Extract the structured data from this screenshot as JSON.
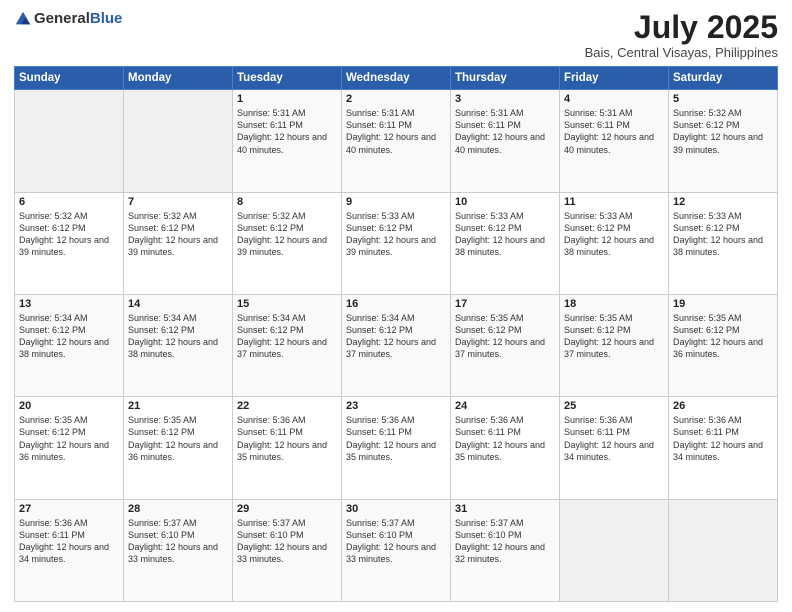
{
  "header": {
    "logo_general": "General",
    "logo_blue": "Blue",
    "title": "July 2025",
    "subtitle": "Bais, Central Visayas, Philippines"
  },
  "weekdays": [
    "Sunday",
    "Monday",
    "Tuesday",
    "Wednesday",
    "Thursday",
    "Friday",
    "Saturday"
  ],
  "weeks": [
    [
      {
        "day": "",
        "text": ""
      },
      {
        "day": "",
        "text": ""
      },
      {
        "day": "1",
        "text": "Sunrise: 5:31 AM\nSunset: 6:11 PM\nDaylight: 12 hours and 40 minutes."
      },
      {
        "day": "2",
        "text": "Sunrise: 5:31 AM\nSunset: 6:11 PM\nDaylight: 12 hours and 40 minutes."
      },
      {
        "day": "3",
        "text": "Sunrise: 5:31 AM\nSunset: 6:11 PM\nDaylight: 12 hours and 40 minutes."
      },
      {
        "day": "4",
        "text": "Sunrise: 5:31 AM\nSunset: 6:11 PM\nDaylight: 12 hours and 40 minutes."
      },
      {
        "day": "5",
        "text": "Sunrise: 5:32 AM\nSunset: 6:12 PM\nDaylight: 12 hours and 39 minutes."
      }
    ],
    [
      {
        "day": "6",
        "text": "Sunrise: 5:32 AM\nSunset: 6:12 PM\nDaylight: 12 hours and 39 minutes."
      },
      {
        "day": "7",
        "text": "Sunrise: 5:32 AM\nSunset: 6:12 PM\nDaylight: 12 hours and 39 minutes."
      },
      {
        "day": "8",
        "text": "Sunrise: 5:32 AM\nSunset: 6:12 PM\nDaylight: 12 hours and 39 minutes."
      },
      {
        "day": "9",
        "text": "Sunrise: 5:33 AM\nSunset: 6:12 PM\nDaylight: 12 hours and 39 minutes."
      },
      {
        "day": "10",
        "text": "Sunrise: 5:33 AM\nSunset: 6:12 PM\nDaylight: 12 hours and 38 minutes."
      },
      {
        "day": "11",
        "text": "Sunrise: 5:33 AM\nSunset: 6:12 PM\nDaylight: 12 hours and 38 minutes."
      },
      {
        "day": "12",
        "text": "Sunrise: 5:33 AM\nSunset: 6:12 PM\nDaylight: 12 hours and 38 minutes."
      }
    ],
    [
      {
        "day": "13",
        "text": "Sunrise: 5:34 AM\nSunset: 6:12 PM\nDaylight: 12 hours and 38 minutes."
      },
      {
        "day": "14",
        "text": "Sunrise: 5:34 AM\nSunset: 6:12 PM\nDaylight: 12 hours and 38 minutes."
      },
      {
        "day": "15",
        "text": "Sunrise: 5:34 AM\nSunset: 6:12 PM\nDaylight: 12 hours and 37 minutes."
      },
      {
        "day": "16",
        "text": "Sunrise: 5:34 AM\nSunset: 6:12 PM\nDaylight: 12 hours and 37 minutes."
      },
      {
        "day": "17",
        "text": "Sunrise: 5:35 AM\nSunset: 6:12 PM\nDaylight: 12 hours and 37 minutes."
      },
      {
        "day": "18",
        "text": "Sunrise: 5:35 AM\nSunset: 6:12 PM\nDaylight: 12 hours and 37 minutes."
      },
      {
        "day": "19",
        "text": "Sunrise: 5:35 AM\nSunset: 6:12 PM\nDaylight: 12 hours and 36 minutes."
      }
    ],
    [
      {
        "day": "20",
        "text": "Sunrise: 5:35 AM\nSunset: 6:12 PM\nDaylight: 12 hours and 36 minutes."
      },
      {
        "day": "21",
        "text": "Sunrise: 5:35 AM\nSunset: 6:12 PM\nDaylight: 12 hours and 36 minutes."
      },
      {
        "day": "22",
        "text": "Sunrise: 5:36 AM\nSunset: 6:11 PM\nDaylight: 12 hours and 35 minutes."
      },
      {
        "day": "23",
        "text": "Sunrise: 5:36 AM\nSunset: 6:11 PM\nDaylight: 12 hours and 35 minutes."
      },
      {
        "day": "24",
        "text": "Sunrise: 5:36 AM\nSunset: 6:11 PM\nDaylight: 12 hours and 35 minutes."
      },
      {
        "day": "25",
        "text": "Sunrise: 5:36 AM\nSunset: 6:11 PM\nDaylight: 12 hours and 34 minutes."
      },
      {
        "day": "26",
        "text": "Sunrise: 5:36 AM\nSunset: 6:11 PM\nDaylight: 12 hours and 34 minutes."
      }
    ],
    [
      {
        "day": "27",
        "text": "Sunrise: 5:36 AM\nSunset: 6:11 PM\nDaylight: 12 hours and 34 minutes."
      },
      {
        "day": "28",
        "text": "Sunrise: 5:37 AM\nSunset: 6:10 PM\nDaylight: 12 hours and 33 minutes."
      },
      {
        "day": "29",
        "text": "Sunrise: 5:37 AM\nSunset: 6:10 PM\nDaylight: 12 hours and 33 minutes."
      },
      {
        "day": "30",
        "text": "Sunrise: 5:37 AM\nSunset: 6:10 PM\nDaylight: 12 hours and 33 minutes."
      },
      {
        "day": "31",
        "text": "Sunrise: 5:37 AM\nSunset: 6:10 PM\nDaylight: 12 hours and 32 minutes."
      },
      {
        "day": "",
        "text": ""
      },
      {
        "day": "",
        "text": ""
      }
    ]
  ]
}
